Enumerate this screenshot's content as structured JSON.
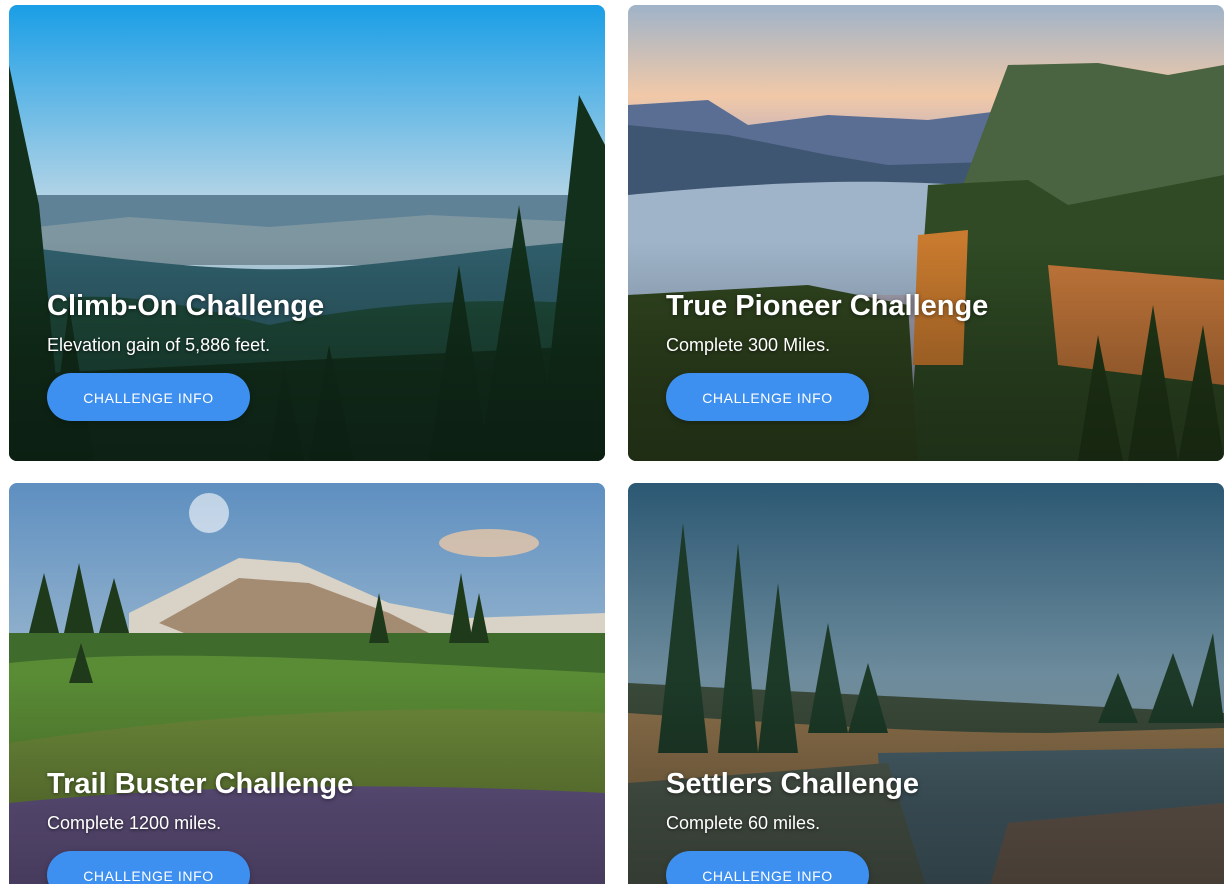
{
  "cards": [
    {
      "title": "Climb-On Challenge",
      "description": "Elevation gain of 5,886 feet.",
      "button_label": "CHALLENGE INFO",
      "image": "forest-valley-image"
    },
    {
      "title": "True Pioneer Challenge",
      "description": "Complete 300 Miles.",
      "button_label": "CHALLENGE INFO",
      "image": "river-gorge-image"
    },
    {
      "title": "Trail Buster Challenge",
      "description": "Complete 1200 miles.",
      "button_label": "CHALLENGE INFO",
      "image": "mountain-meadow-image"
    },
    {
      "title": "Settlers Challenge",
      "description": "Complete 60 miles.",
      "button_label": "CHALLENGE INFO",
      "image": "river-forest-image"
    }
  ],
  "colors": {
    "button": "#3d8ff0",
    "text": "#ffffff"
  }
}
